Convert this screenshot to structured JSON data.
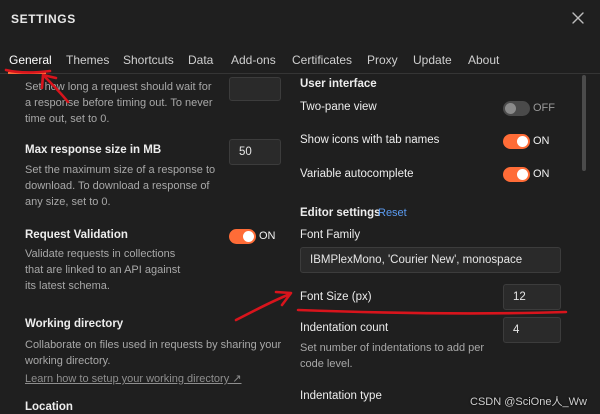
{
  "window": {
    "title": "SETTINGS"
  },
  "tabs": [
    {
      "label": "General"
    },
    {
      "label": "Themes"
    },
    {
      "label": "Shortcuts"
    },
    {
      "label": "Data"
    },
    {
      "label": "Add-ons"
    },
    {
      "label": "Certificates"
    },
    {
      "label": "Proxy"
    },
    {
      "label": "Update"
    },
    {
      "label": "About"
    }
  ],
  "left": {
    "timeout_desc": [
      "Set how long a request should wait for",
      "a response before timing out. To never",
      "time out, set to 0."
    ],
    "max_response": {
      "label": "Max response size in MB",
      "value": "50",
      "desc": [
        "Set the maximum size of a response to",
        "download. To download a response of",
        "any size, set to 0."
      ]
    },
    "request_validation": {
      "label": "Request Validation",
      "state": "ON",
      "desc": [
        "Validate requests in collections",
        "that are linked to an API against",
        "its latest schema."
      ]
    },
    "working_directory": {
      "label": "Working directory",
      "desc": [
        "Collaborate on files used in requests by sharing your",
        "working directory."
      ],
      "link": "Learn how to setup your working directory ↗"
    },
    "location": {
      "label": "Location"
    }
  },
  "right": {
    "user_interface": {
      "heading": "User interface",
      "two_pane": {
        "label": "Two-pane view",
        "state": "OFF"
      },
      "show_icons": {
        "label": "Show icons with tab names",
        "state": "ON"
      },
      "var_autocomplete": {
        "label": "Variable autocomplete",
        "state": "ON"
      }
    },
    "editor": {
      "heading": "Editor settings",
      "reset": "Reset",
      "font_family": {
        "label": "Font Family",
        "value": "IBMPlexMono, 'Courier New', monospace"
      },
      "font_size": {
        "label": "Font Size (px)",
        "value": "12"
      },
      "indent_count": {
        "label": "Indentation count",
        "value": "4",
        "desc": [
          "Set number of indentations to add per",
          "code level."
        ]
      },
      "indent_type": {
        "label": "Indentation type"
      }
    }
  },
  "watermark": "CSDN @SciOne人_Ww",
  "colors": {
    "accent": "#ff6c37",
    "annotation": "#d8141c",
    "background": "#1f1f1f",
    "link": "#5b9bf0"
  }
}
